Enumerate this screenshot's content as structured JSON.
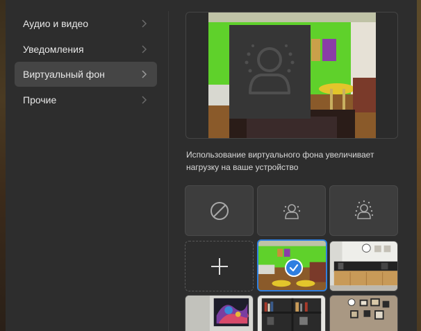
{
  "sidebar": {
    "items": [
      {
        "label": "Аудио и видео",
        "active": false
      },
      {
        "label": "Уведомления",
        "active": false
      },
      {
        "label": "Виртуальный фон",
        "active": true
      },
      {
        "label": "Прочие",
        "active": false
      }
    ]
  },
  "main": {
    "notice": "Использование виртуального фона увеличивает нагрузку на ваше устройство",
    "tiles": [
      {
        "icon": "no-background-icon"
      },
      {
        "icon": "blur-slight-icon"
      },
      {
        "icon": "blur-strong-icon"
      },
      {
        "icon": "add-icon"
      },
      {
        "icon": "green-office-thumbnail",
        "selected": true
      },
      {
        "icon": "kitchen-thumbnail"
      },
      {
        "icon": "art-wall-thumbnail"
      },
      {
        "icon": "bookshelf-thumbnail"
      },
      {
        "icon": "brick-wall-thumbnail"
      }
    ]
  },
  "colors": {
    "accent": "#2f7fe0",
    "panel": "#2d2d2d",
    "active_item": "#454545",
    "green_wall": "#5fd12b"
  }
}
